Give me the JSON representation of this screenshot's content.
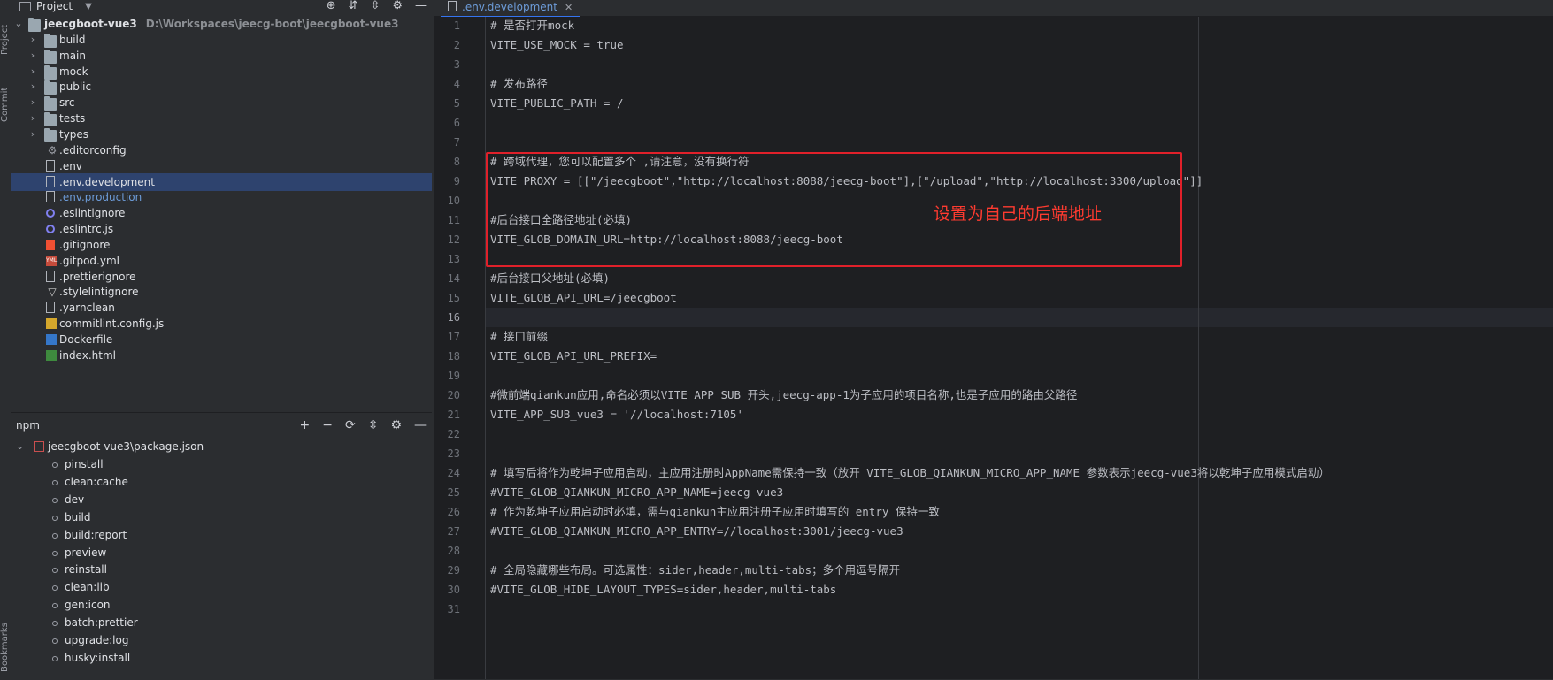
{
  "left_strip": {
    "top_label": "Project",
    "second_label": "Commit",
    "bottom_label": "Bookmarks"
  },
  "project_panel": {
    "title": "Project",
    "root": {
      "name": "jeecgboot-vue3",
      "path": "D:\\Workspaces\\jeecg-boot\\jeecgboot-vue3"
    },
    "items": [
      {
        "name": "build",
        "type": "folder"
      },
      {
        "name": "main",
        "type": "folder"
      },
      {
        "name": "mock",
        "type": "folder"
      },
      {
        "name": "public",
        "type": "folder"
      },
      {
        "name": "src",
        "type": "folder"
      },
      {
        "name": "tests",
        "type": "folder"
      },
      {
        "name": "types",
        "type": "folder"
      },
      {
        "name": ".editorconfig",
        "type": "gear-file"
      },
      {
        "name": ".env",
        "type": "file"
      },
      {
        "name": ".env.development",
        "type": "file",
        "selected": true
      },
      {
        "name": ".env.production",
        "type": "file",
        "highlight": true
      },
      {
        "name": ".eslintignore",
        "type": "eslint"
      },
      {
        "name": ".eslintrc.js",
        "type": "eslint"
      },
      {
        "name": ".gitignore",
        "type": "git"
      },
      {
        "name": ".gitpod.yml",
        "type": "yaml"
      },
      {
        "name": ".prettierignore",
        "type": "file"
      },
      {
        "name": ".stylelintignore",
        "type": "style"
      },
      {
        "name": ".yarnclean",
        "type": "file"
      },
      {
        "name": "commitlint.config.js",
        "type": "js"
      },
      {
        "name": "Dockerfile",
        "type": "docker"
      },
      {
        "name": "index.html",
        "type": "html"
      }
    ]
  },
  "npm_panel": {
    "title": "npm",
    "package": "jeecgboot-vue3\\package.json",
    "scripts": [
      "pinstall",
      "clean:cache",
      "dev",
      "build",
      "build:report",
      "preview",
      "reinstall",
      "clean:lib",
      "gen:icon",
      "batch:prettier",
      "upgrade:log",
      "husky:install"
    ]
  },
  "editor": {
    "tab_label": ".env.development",
    "current_line": 16,
    "lines": [
      "# 是否打开mock",
      "VITE_USE_MOCK = true",
      "",
      "# 发布路径",
      "VITE_PUBLIC_PATH = /",
      "",
      "",
      "# 跨域代理，您可以配置多个 ,请注意，没有换行符",
      "VITE_PROXY = [[\"/jeecgboot\",\"http://localhost:8088/jeecg-boot\"],[\"/upload\",\"http://localhost:3300/upload\"]]",
      "",
      "#后台接口全路径地址(必填)",
      "VITE_GLOB_DOMAIN_URL=http://localhost:8088/jeecg-boot",
      "",
      "#后台接口父地址(必填)",
      "VITE_GLOB_API_URL=/jeecgboot",
      "",
      "# 接口前缀",
      "VITE_GLOB_API_URL_PREFIX=",
      "",
      "#微前端qiankun应用,命名必须以VITE_APP_SUB_开头,jeecg-app-1为子应用的项目名称,也是子应用的路由父路径",
      "VITE_APP_SUB_vue3 = '//localhost:7105'",
      "",
      "",
      "# 填写后将作为乾坤子应用启动，主应用注册时AppName需保持一致（放开 VITE_GLOB_QIANKUN_MICRO_APP_NAME 参数表示jeecg-vue3将以乾坤子应用模式启动）",
      "#VITE_GLOB_QIANKUN_MICRO_APP_NAME=jeecg-vue3",
      "# 作为乾坤子应用启动时必填，需与qiankun主应用注册子应用时填写的 entry 保持一致",
      "#VITE_GLOB_QIANKUN_MICRO_APP_ENTRY=//localhost:3001/jeecg-vue3",
      "",
      "# 全局隐藏哪些布局。可选属性：sider,header,multi-tabs；多个用逗号隔开",
      "#VITE_GLOB_HIDE_LAYOUT_TYPES=sider,header,multi-tabs",
      ""
    ],
    "annotation": "设置为自己的后端地址",
    "annotation_color": "#ff3b30",
    "highlight_box_color": "#e0202a"
  }
}
